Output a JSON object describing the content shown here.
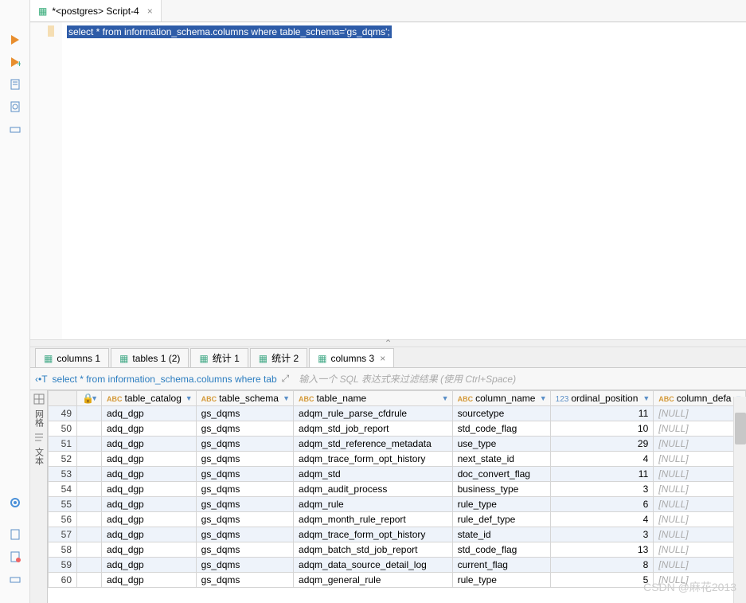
{
  "editor": {
    "tab_title": "*<postgres> Script-4",
    "sql": "select * from information_schema.columns where table_schema='gs_dqms';"
  },
  "result_tabs": [
    {
      "label": "columns 1"
    },
    {
      "label": "tables 1 (2)"
    },
    {
      "label": "统计 1"
    },
    {
      "label": "统计 2"
    },
    {
      "label": "columns 3",
      "active": true
    }
  ],
  "filter": {
    "sql_preview": "select * from information_schema.columns where tab",
    "placeholder": "输入一个 SQL 表达式来过滤结果 (使用 Ctrl+Space)"
  },
  "grid_side": {
    "tab1": "网格",
    "tab2": "文本"
  },
  "columns": [
    {
      "type": "lock",
      "label": ""
    },
    {
      "type": "abc",
      "label": "table_catalog"
    },
    {
      "type": "abc",
      "label": "table_schema"
    },
    {
      "type": "abc",
      "label": "table_name"
    },
    {
      "type": "abc",
      "label": "column_name"
    },
    {
      "type": "num",
      "label": "ordinal_position"
    },
    {
      "type": "abc",
      "label": "column_defa"
    }
  ],
  "rows": [
    {
      "n": 49,
      "c": [
        "adq_dgp",
        "gs_dqms",
        "adqm_rule_parse_cfdrule",
        "sourcetype",
        "11",
        "[NULL]"
      ]
    },
    {
      "n": 50,
      "c": [
        "adq_dgp",
        "gs_dqms",
        "adqm_std_job_report",
        "std_code_flag",
        "10",
        "[NULL]"
      ]
    },
    {
      "n": 51,
      "c": [
        "adq_dgp",
        "gs_dqms",
        "adqm_std_reference_metadata",
        "use_type",
        "29",
        "[NULL]"
      ]
    },
    {
      "n": 52,
      "c": [
        "adq_dgp",
        "gs_dqms",
        "adqm_trace_form_opt_history",
        "next_state_id",
        "4",
        "[NULL]"
      ]
    },
    {
      "n": 53,
      "c": [
        "adq_dgp",
        "gs_dqms",
        "adqm_std",
        "doc_convert_flag",
        "11",
        "[NULL]"
      ]
    },
    {
      "n": 54,
      "c": [
        "adq_dgp",
        "gs_dqms",
        "adqm_audit_process",
        "business_type",
        "3",
        "[NULL]"
      ]
    },
    {
      "n": 55,
      "c": [
        "adq_dgp",
        "gs_dqms",
        "adqm_rule",
        "rule_type",
        "6",
        "[NULL]"
      ]
    },
    {
      "n": 56,
      "c": [
        "adq_dgp",
        "gs_dqms",
        "adqm_month_rule_report",
        "rule_def_type",
        "4",
        "[NULL]"
      ]
    },
    {
      "n": 57,
      "c": [
        "adq_dgp",
        "gs_dqms",
        "adqm_trace_form_opt_history",
        "state_id",
        "3",
        "[NULL]"
      ]
    },
    {
      "n": 58,
      "c": [
        "adq_dgp",
        "gs_dqms",
        "adqm_batch_std_job_report",
        "std_code_flag",
        "13",
        "[NULL]"
      ]
    },
    {
      "n": 59,
      "c": [
        "adq_dgp",
        "gs_dqms",
        "adqm_data_source_detail_log",
        "current_flag",
        "8",
        "[NULL]"
      ]
    },
    {
      "n": 60,
      "c": [
        "adq_dgp",
        "gs_dqms",
        "adqm_general_rule",
        "rule_type",
        "5",
        "[NULL]"
      ]
    }
  ],
  "watermark": "CSDN @麻花2013"
}
